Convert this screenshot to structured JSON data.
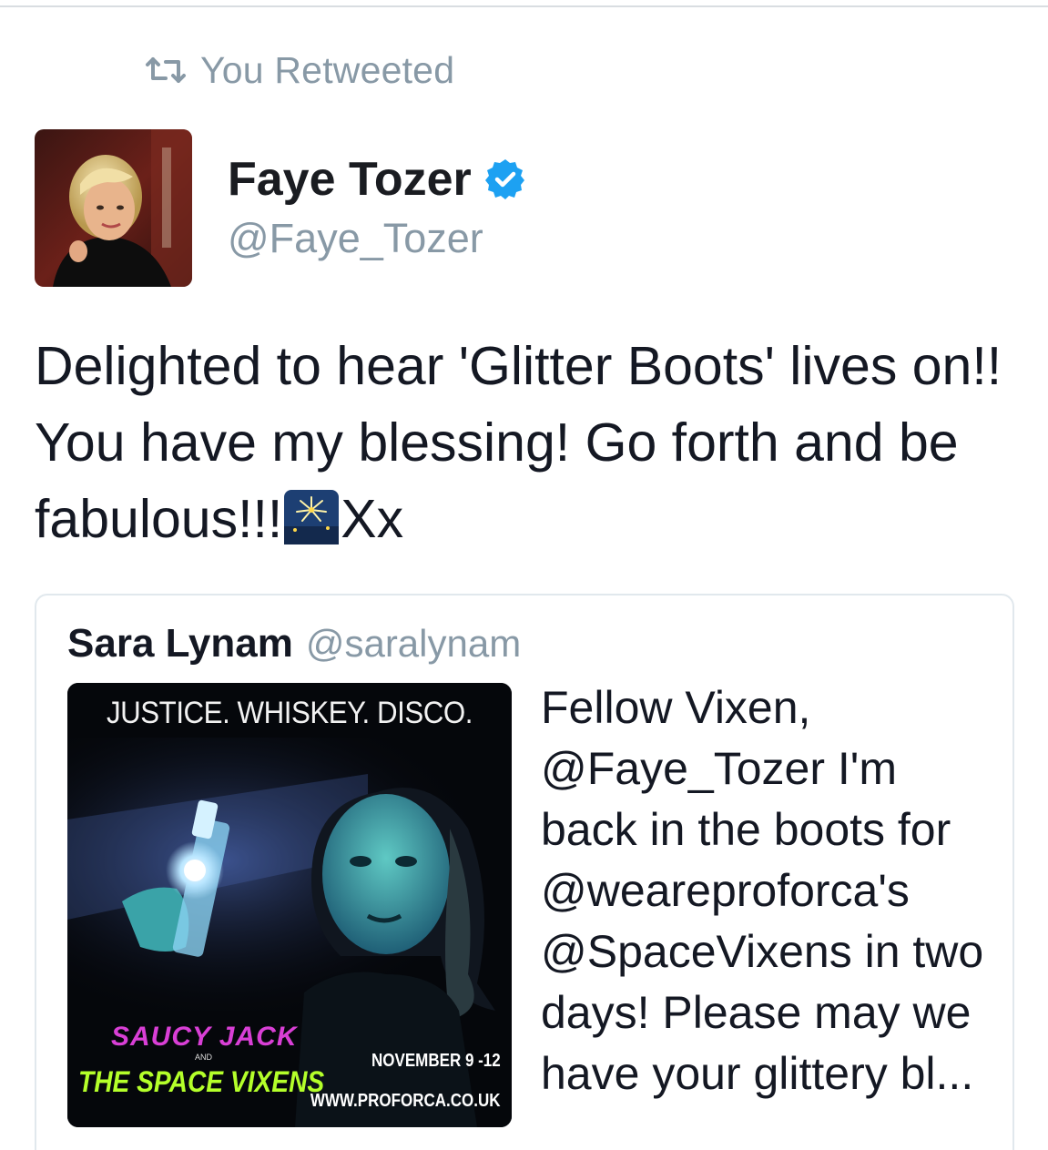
{
  "retweet": {
    "label": "You Retweeted",
    "icon": "retweet-icon"
  },
  "tweet": {
    "author_name": "Faye Tozer",
    "author_handle": "@Faye_Tozer",
    "verified": true,
    "text_before_emoji": "Delighted to hear 'Glitter Boots' lives on!! You have my blessing! Go forth and be fabulous!!!",
    "emoji": "fireworks-emoji",
    "text_after_emoji": "Xx"
  },
  "quoted_tweet": {
    "author_name": "Sara Lynam",
    "author_handle": "@saralynam",
    "text": "Fellow Vixen, @Faye_Tozer I'm back in the boots for @weareproforca's @SpaceVixens in two days! Please may we have your glittery bl...",
    "media": {
      "headline": "JUSTICE. WHISKEY. DISCO.",
      "title_line_1": "SAUCY JACK",
      "title_and": "AND",
      "title_line_2": "THE SPACE VIXENS",
      "dates": "NOVEMBER 9 -12",
      "url": "WWW.PROFORCA.CO.UK"
    }
  },
  "colors": {
    "text": "#141823",
    "muted": "#8899a6",
    "verified": "#1da1f2",
    "border": "#e1e8ed"
  }
}
